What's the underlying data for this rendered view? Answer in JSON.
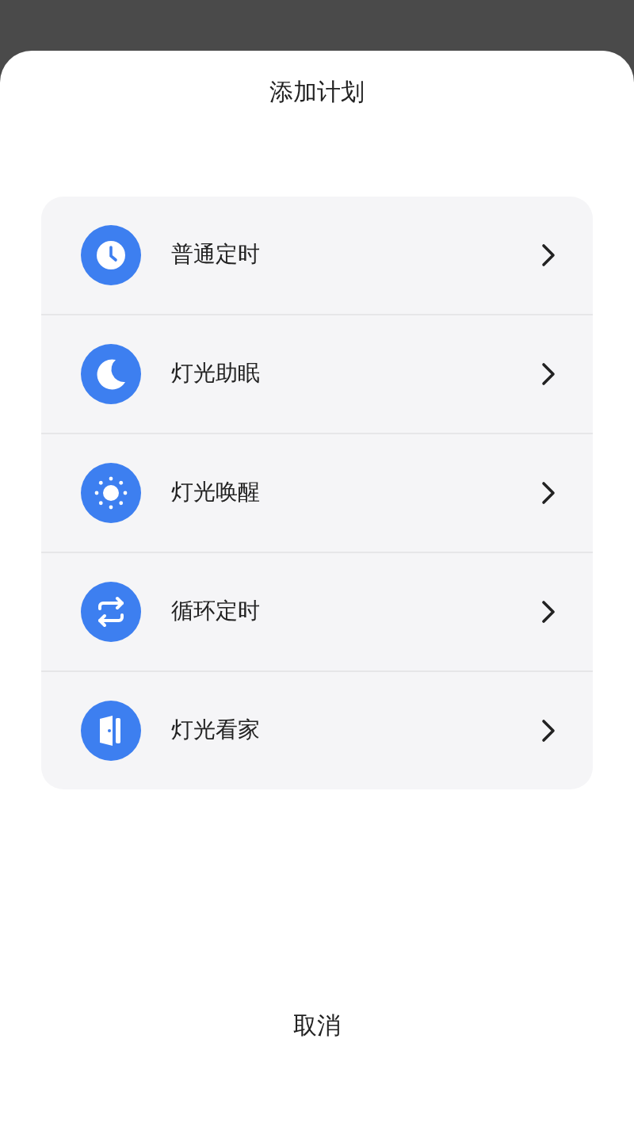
{
  "sheet": {
    "title": "添加计划"
  },
  "plans": [
    {
      "kind": "clock",
      "label": "普通定时"
    },
    {
      "kind": "moon",
      "label": "灯光助眠"
    },
    {
      "kind": "sun",
      "label": "灯光唤醒"
    },
    {
      "kind": "repeat",
      "label": "循环定时"
    },
    {
      "kind": "door",
      "label": "灯光看家"
    }
  ],
  "cancel": "取消"
}
